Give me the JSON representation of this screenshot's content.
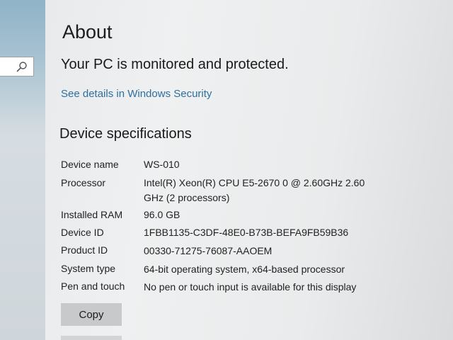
{
  "page": {
    "title": "About",
    "protection_status": "Your PC is monitored and protected.",
    "security_link": "See details in Windows Security"
  },
  "sidebar": {
    "search_icon": "search-icon"
  },
  "device_specs": {
    "section_title": "Device specifications",
    "rows": [
      {
        "label": "Device name",
        "value": "WS-010"
      },
      {
        "label": "Processor",
        "value": "Intel(R) Xeon(R) CPU E5-2670 0 @ 2.60GHz   2.60 GHz  (2 processors)"
      },
      {
        "label": "Installed RAM",
        "value": "96.0 GB"
      },
      {
        "label": "Device ID",
        "value": "1FBB1135-C3DF-48E0-B73B-BEFA9FB59B36"
      },
      {
        "label": "Product ID",
        "value": "00330-71275-76087-AAOEM"
      },
      {
        "label": "System type",
        "value": "64-bit operating system, x64-based processor"
      },
      {
        "label": "Pen and touch",
        "value": "No pen or touch input is available for this display"
      }
    ],
    "copy_label": "Copy"
  },
  "colors": {
    "link": "#2e6f9e",
    "button_bg": "#c7c9ca",
    "text": "#1a1a1a"
  }
}
